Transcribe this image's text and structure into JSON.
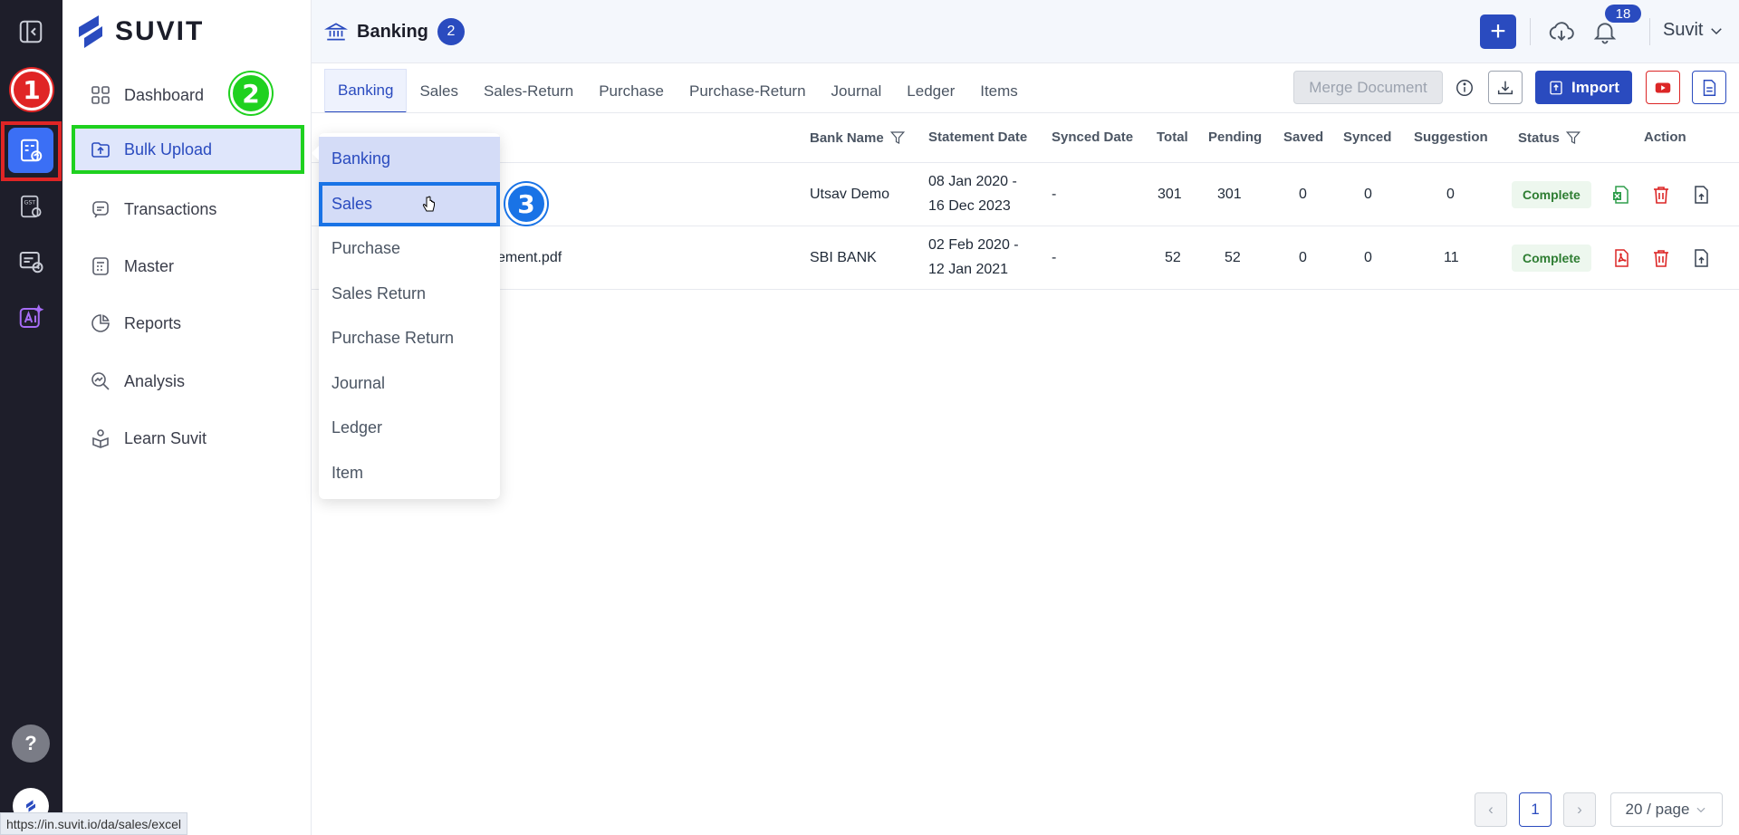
{
  "brand": {
    "name": "SUVIT"
  },
  "rail": {
    "items": [
      {
        "icon": "sidebar-collapse-icon"
      },
      {
        "icon": "bulk-upload-icon",
        "active": true
      },
      {
        "icon": "gst-icon",
        "text": "GST"
      },
      {
        "icon": "message-clock-icon"
      },
      {
        "icon": "ai-icon"
      }
    ],
    "help_label": "?"
  },
  "steps": {
    "one": "1",
    "two": "2",
    "three": "3"
  },
  "sidenav": {
    "items": [
      {
        "label": "Dashboard",
        "icon": "dashboard-icon"
      },
      {
        "label": "Bulk Upload",
        "icon": "upload-icon",
        "active": true
      },
      {
        "label": "Transactions",
        "icon": "transactions-icon"
      },
      {
        "label": "Master",
        "icon": "master-icon"
      },
      {
        "label": "Reports",
        "icon": "reports-icon"
      },
      {
        "label": "Analysis",
        "icon": "analysis-icon"
      },
      {
        "label": "Learn Suvit",
        "icon": "learn-icon"
      }
    ]
  },
  "flyout": {
    "items": [
      "Banking",
      "Sales",
      "Purchase",
      "Sales Return",
      "Purchase Return",
      "Journal",
      "Ledger",
      "Item"
    ],
    "hovered": "Banking",
    "selected": "Sales"
  },
  "header": {
    "title": "Banking",
    "count": "2",
    "notifications": "18",
    "user": "Suvit"
  },
  "tabs": [
    "Banking",
    "Sales",
    "Sales-Return",
    "Purchase",
    "Purchase-Return",
    "Journal",
    "Ledger",
    "Items"
  ],
  "toolbar": {
    "merge_label": "Merge Document",
    "import_label": "Import"
  },
  "table": {
    "columns": [
      "Bank Name",
      "Statement Date",
      "Synced Date",
      "Total",
      "Pending",
      "Saved",
      "Synced",
      "Suggestion",
      "Status",
      "Action"
    ],
    "rows": [
      {
        "file": "",
        "bank": "Utsav Demo",
        "date_from": "08 Jan 2020 -",
        "date_to": "16 Dec 2023",
        "synced_date": "-",
        "total": "301",
        "pending": "301",
        "saved": "0",
        "synced": "0",
        "suggestion": "0",
        "status": "Complete",
        "file_icon": "excel-icon"
      },
      {
        "file": "ement.pdf",
        "bank": "SBI BANK",
        "date_from": "02 Feb 2020 -",
        "date_to": "12 Jan 2021",
        "synced_date": "-",
        "total": "52",
        "pending": "52",
        "saved": "0",
        "synced": "0",
        "suggestion": "11",
        "status": "Complete",
        "file_icon": "pdf-icon"
      }
    ]
  },
  "pagination": {
    "current": "1",
    "page_size": "20 / page"
  },
  "status_bar": {
    "url": "https://in.suvit.io/da/sales/excel"
  },
  "colors": {
    "primary": "#2a4bbf",
    "rail": "#1e1e2a",
    "step1": "#e02525",
    "step2": "#1fd11f",
    "step3": "#1973e6",
    "complete": "#2e7d32"
  }
}
